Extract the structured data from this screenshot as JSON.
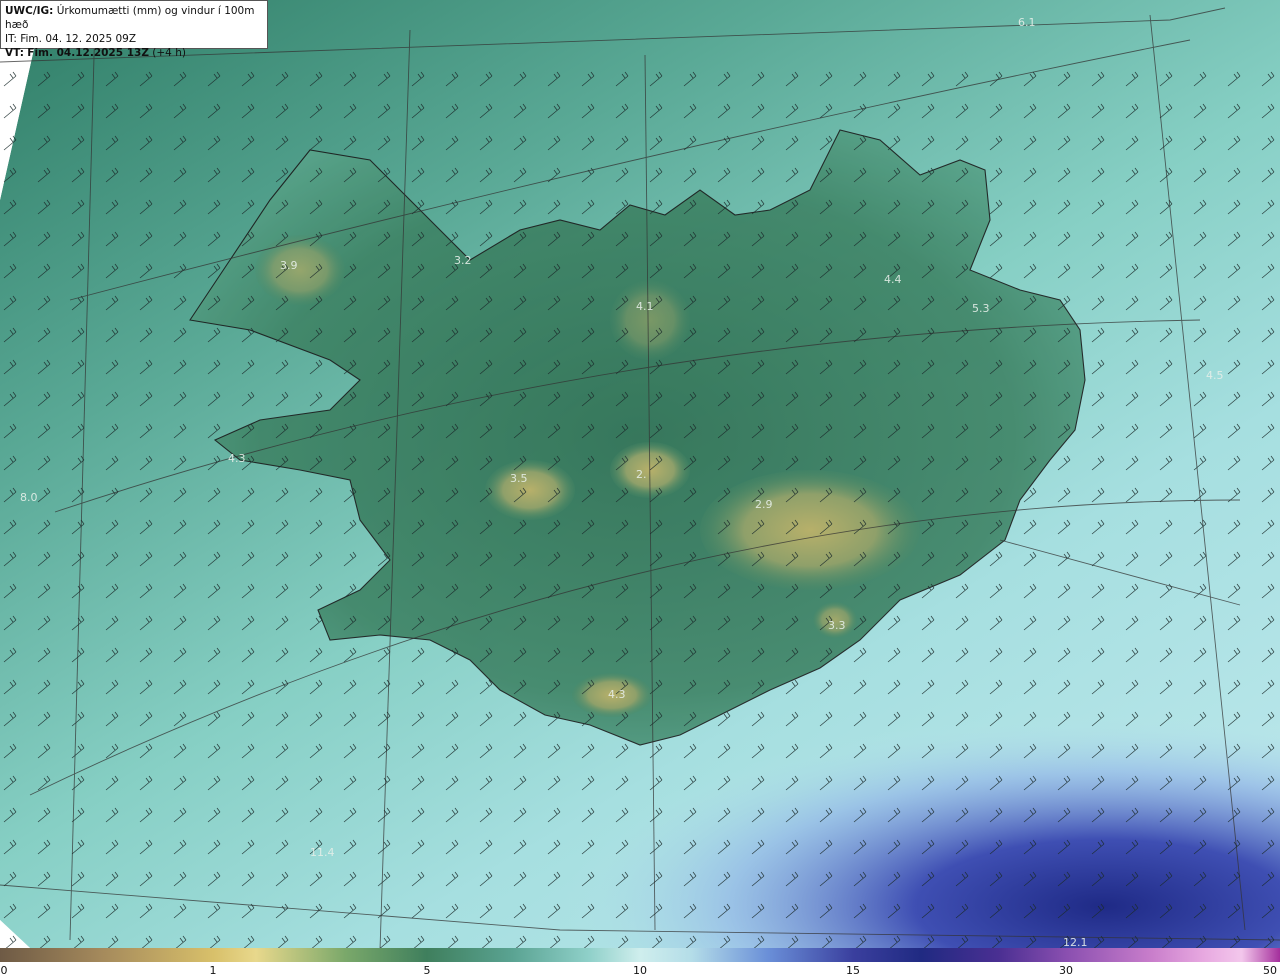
{
  "header": {
    "model": "UWC/IG:",
    "title": "Úrkomumætti (mm) og vindur í 100m hæð",
    "issue_time": "IT: Fim. 04. 12. 2025 09Z",
    "valid_prefix": "VT:",
    "valid_time": "Fim. 04.12.2025 13Z",
    "lead": "(+4 h)"
  },
  "map_values": [
    {
      "text": "6.1"
    },
    {
      "text": "3.9"
    },
    {
      "text": "3.2"
    },
    {
      "text": "4.1"
    },
    {
      "text": "4.4"
    },
    {
      "text": "5.3"
    },
    {
      "text": "4.5"
    },
    {
      "text": "4.3"
    },
    {
      "text": "8.0"
    },
    {
      "text": "3.5"
    },
    {
      "text": "2."
    },
    {
      "text": "2.9"
    },
    {
      "text": "3.3"
    },
    {
      "text": "4.3"
    },
    {
      "text": "11.4"
    },
    {
      "text": "12.1"
    }
  ],
  "colorbar": {
    "ticks": [
      "0",
      "1",
      "5",
      "10",
      "15",
      "30",
      "50"
    ],
    "colors": {
      "low": "#6e5a45",
      "mid_green": "#3f7f5d",
      "pale": "#cfeeed",
      "blue": "#202a82",
      "purple": "#a42f9c"
    }
  },
  "legend": {
    "field": "precipitable water",
    "wind": "wind barbs"
  }
}
